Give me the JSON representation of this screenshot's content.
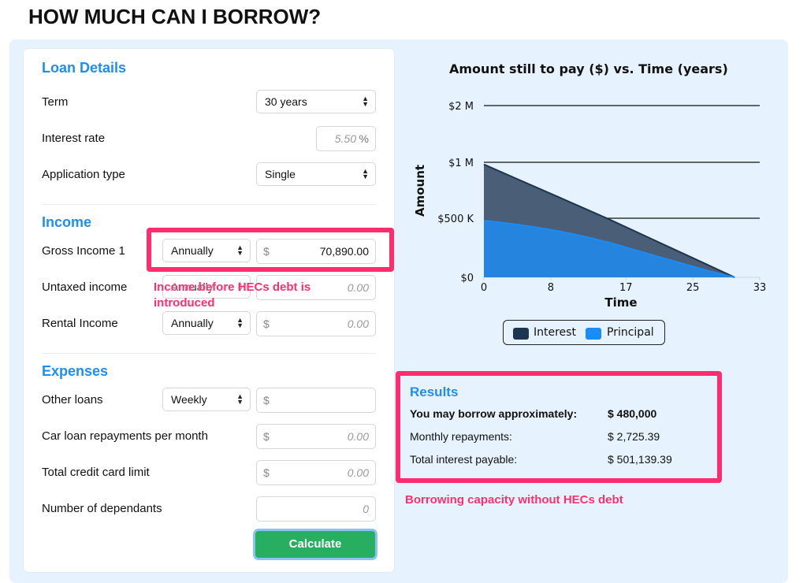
{
  "page": {
    "title": "HOW MUCH CAN I BORROW?"
  },
  "loan_details": {
    "title": "Loan Details",
    "term": {
      "label": "Term",
      "value": "30 years"
    },
    "interest_rate": {
      "label": "Interest rate",
      "placeholder": "5.50",
      "unit": "%"
    },
    "application_type": {
      "label": "Application type",
      "value": "Single"
    }
  },
  "income": {
    "title": "Income",
    "gross_income_1": {
      "label": "Gross Income 1",
      "frequency": "Annually",
      "currency": "$",
      "value": "70,890.00"
    },
    "untaxed_income": {
      "label": "Untaxed income",
      "frequency": "Annually",
      "placeholder": "0.00"
    },
    "rental_income": {
      "label": "Rental Income",
      "frequency": "Annually",
      "currency": "$",
      "placeholder": "0.00"
    }
  },
  "expenses": {
    "title": "Expenses",
    "other_loans": {
      "label": "Other loans",
      "frequency": "Weekly",
      "currency": "$",
      "value": ""
    },
    "car_loan": {
      "label": "Car loan repayments per month",
      "currency": "$",
      "placeholder": "0.00"
    },
    "credit_card": {
      "label": "Total credit card limit",
      "currency": "$",
      "placeholder": "0.00"
    },
    "dependants": {
      "label": "Number of dependants",
      "placeholder": "0"
    }
  },
  "calculate_label": "Calculate",
  "annotations": {
    "income_note_line1": "Income before HECs debt is",
    "income_note_line2": "introduced",
    "results_note": "Borrowing capacity without HECs debt",
    "highlight_color": "#ff2d6d"
  },
  "results": {
    "title": "Results",
    "borrow_label": "You may borrow approximately:",
    "borrow_value": "$ 480,000",
    "monthly_label": "Monthly repayments:",
    "monthly_value": "$ 2,725.39",
    "interest_label": "Total interest payable:",
    "interest_value": "$ 501,139.39"
  },
  "chart_data": {
    "type": "area",
    "title": "Amount still to pay ($) vs. Time (years)",
    "xlabel": "Time",
    "ylabel": "Amount",
    "xlim": [
      0,
      33
    ],
    "ylim": [
      0,
      2000000
    ],
    "x_ticks": [
      "0",
      "8",
      "17",
      "25",
      "33"
    ],
    "x_tick_values": [
      0,
      8,
      17,
      25,
      33
    ],
    "y_ticks": [
      "$0",
      "$500 K",
      "$1 M",
      "$2 M"
    ],
    "y_tick_values": [
      0,
      500000,
      1000000,
      2000000
    ],
    "grid": true,
    "legend_position": "bottom",
    "x": [
      0,
      3,
      6,
      9,
      12,
      15,
      18,
      21,
      24,
      27,
      30
    ],
    "series": [
      {
        "name": "Interest",
        "color": "#1c3550",
        "fill": "#4b5e78",
        "values": [
          981139,
          883025,
          784911,
          686797,
          588683,
          490570,
          392456,
          294342,
          196228,
          98114,
          0
        ]
      },
      {
        "name": "Principal",
        "color": "#1a8cf5",
        "fill": "#2584de",
        "values": [
          480000,
          456000,
          426000,
          390000,
          346000,
          294000,
          233000,
          172000,
          112000,
          52000,
          0
        ]
      }
    ]
  }
}
